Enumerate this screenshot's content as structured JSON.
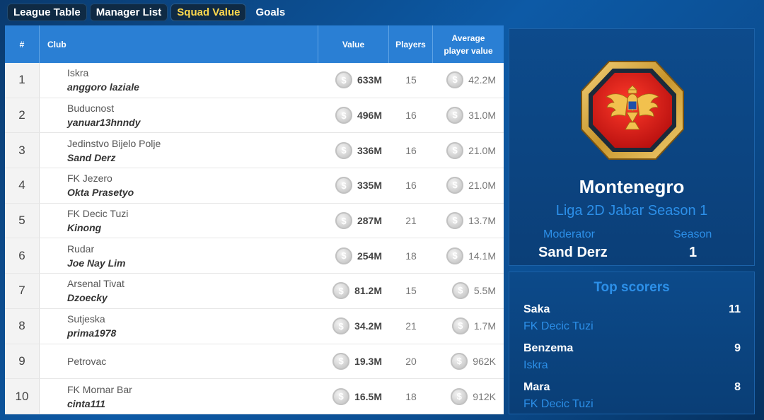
{
  "tabs": [
    {
      "label": "League Table"
    },
    {
      "label": "Manager List"
    },
    {
      "label": "Squad Value"
    },
    {
      "label": "Goals"
    }
  ],
  "table": {
    "headers": {
      "rank": "#",
      "club": "Club",
      "value": "Value",
      "players": "Players",
      "avg_line1": "Average",
      "avg_line2": "player value"
    },
    "coin_symbol": "$",
    "rows": [
      {
        "rank": "1",
        "club": "Iskra",
        "manager": "anggoro laziale",
        "value": "633M",
        "players": "15",
        "avg": "42.2M"
      },
      {
        "rank": "2",
        "club": "Buducnost",
        "manager": "yanuar13hnndy",
        "value": "496M",
        "players": "16",
        "avg": "31.0M"
      },
      {
        "rank": "3",
        "club": "Jedinstvo Bijelo Polje",
        "manager": "Sand Derz",
        "value": "336M",
        "players": "16",
        "avg": "21.0M"
      },
      {
        "rank": "4",
        "club": "FK Jezero",
        "manager": "Okta Prasetyo",
        "value": "335M",
        "players": "16",
        "avg": "21.0M"
      },
      {
        "rank": "5",
        "club": "FK Decic Tuzi",
        "manager": "Kinong",
        "value": "287M",
        "players": "21",
        "avg": "13.7M"
      },
      {
        "rank": "6",
        "club": "Rudar",
        "manager": "Joe Nay Lim",
        "value": "254M",
        "players": "18",
        "avg": "14.1M"
      },
      {
        "rank": "7",
        "club": "Arsenal Tivat",
        "manager": "Dzoecky",
        "value": "81.2M",
        "players": "15",
        "avg": "5.5M"
      },
      {
        "rank": "8",
        "club": "Sutjeska",
        "manager": "prima1978",
        "value": "34.2M",
        "players": "21",
        "avg": "1.7M"
      },
      {
        "rank": "9",
        "club": "Petrovac",
        "manager": "",
        "value": "19.3M",
        "players": "20",
        "avg": "962K"
      },
      {
        "rank": "10",
        "club": "FK Mornar Bar",
        "manager": "cinta111",
        "value": "16.5M",
        "players": "18",
        "avg": "912K"
      }
    ]
  },
  "league": {
    "badge_icon": "montenegro-eagle-icon",
    "country": "Montenegro",
    "name": "Liga 2D Jabar Season 1",
    "moderator_label": "Moderator",
    "moderator": "Sand Derz",
    "season_label": "Season",
    "season": "1"
  },
  "top_scorers": {
    "title": "Top scorers",
    "items": [
      {
        "name": "Saka",
        "club": "FK Decic Tuzi",
        "goals": "11"
      },
      {
        "name": "Benzema",
        "club": "Iskra",
        "goals": "9"
      },
      {
        "name": "Mara",
        "club": "FK Decic Tuzi",
        "goals": "8"
      }
    ]
  },
  "colors": {
    "accent": "#2c8fe8",
    "header": "#2a7fd4",
    "active_tab": "#ffd84d",
    "flag_red": "#d7141a",
    "gold": "#d4a93a"
  }
}
